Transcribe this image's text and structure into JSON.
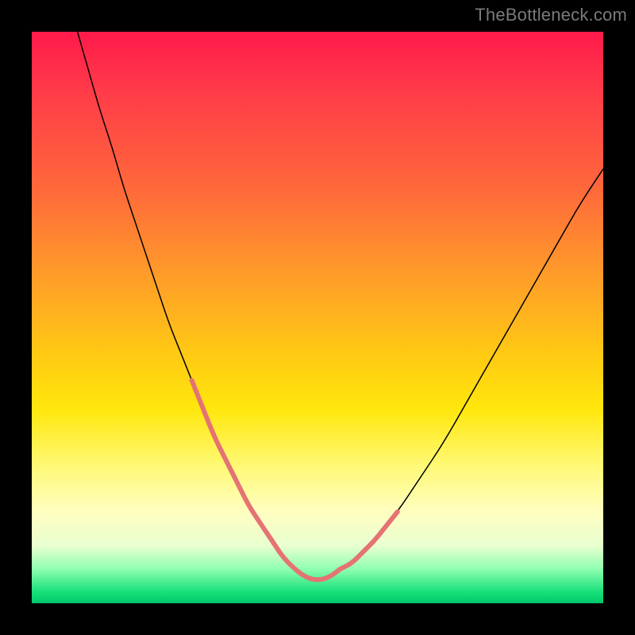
{
  "watermark": "TheBottleneck.com",
  "colors": {
    "background_frame": "#000000",
    "gradient_top": "#ff1a4b",
    "gradient_mid1": "#ff9a2a",
    "gradient_mid2": "#ffe70c",
    "gradient_bottom": "#00c86a",
    "curve_stroke": "#000000",
    "dash_stroke": "#e57373"
  },
  "chart_data": {
    "type": "line",
    "title": "",
    "xlabel": "",
    "ylabel": "",
    "xlim": [
      0,
      100
    ],
    "ylim": [
      0,
      100
    ],
    "grid": false,
    "legend": false,
    "note": "Axes are unlabeled; values estimated from pixel positions. x in [0,100] left→right, y in [0,100] top→bottom (so lower y = higher on screen).",
    "series": [
      {
        "name": "bottleneck-curve",
        "stroke": "#000000",
        "x": [
          8,
          10,
          12,
          14,
          16,
          18,
          20,
          22,
          24,
          26,
          28,
          30,
          32,
          34,
          36,
          38,
          40,
          42,
          44,
          46,
          48,
          50,
          52,
          56,
          60,
          64,
          68,
          72,
          76,
          80,
          84,
          88,
          92,
          96,
          100
        ],
        "y": [
          0,
          7,
          14,
          20,
          27,
          33,
          39,
          45,
          51,
          56,
          61,
          66,
          71,
          75,
          79,
          83,
          86,
          89,
          92,
          94,
          95.5,
          96,
          95.5,
          93,
          89,
          84,
          78,
          72,
          65,
          58,
          51,
          44,
          37,
          30,
          24
        ]
      },
      {
        "name": "highlight-dashes-left",
        "stroke": "#e57373",
        "style": "dashed",
        "x": [
          28,
          30,
          32,
          34,
          36,
          38,
          40,
          42
        ],
        "y": [
          61,
          66,
          71,
          75,
          79,
          83,
          86,
          89
        ]
      },
      {
        "name": "highlight-dashes-bottom",
        "stroke": "#e57373",
        "style": "dashed",
        "x": [
          42,
          44,
          46,
          48,
          50,
          52,
          54
        ],
        "y": [
          89,
          92,
          94,
          95.5,
          96,
          95.5,
          94
        ]
      },
      {
        "name": "highlight-dashes-right",
        "stroke": "#e57373",
        "style": "dashed",
        "x": [
          54,
          56,
          58,
          60,
          62,
          64
        ],
        "y": [
          94,
          93,
          91,
          89,
          86.5,
          84
        ]
      }
    ]
  }
}
